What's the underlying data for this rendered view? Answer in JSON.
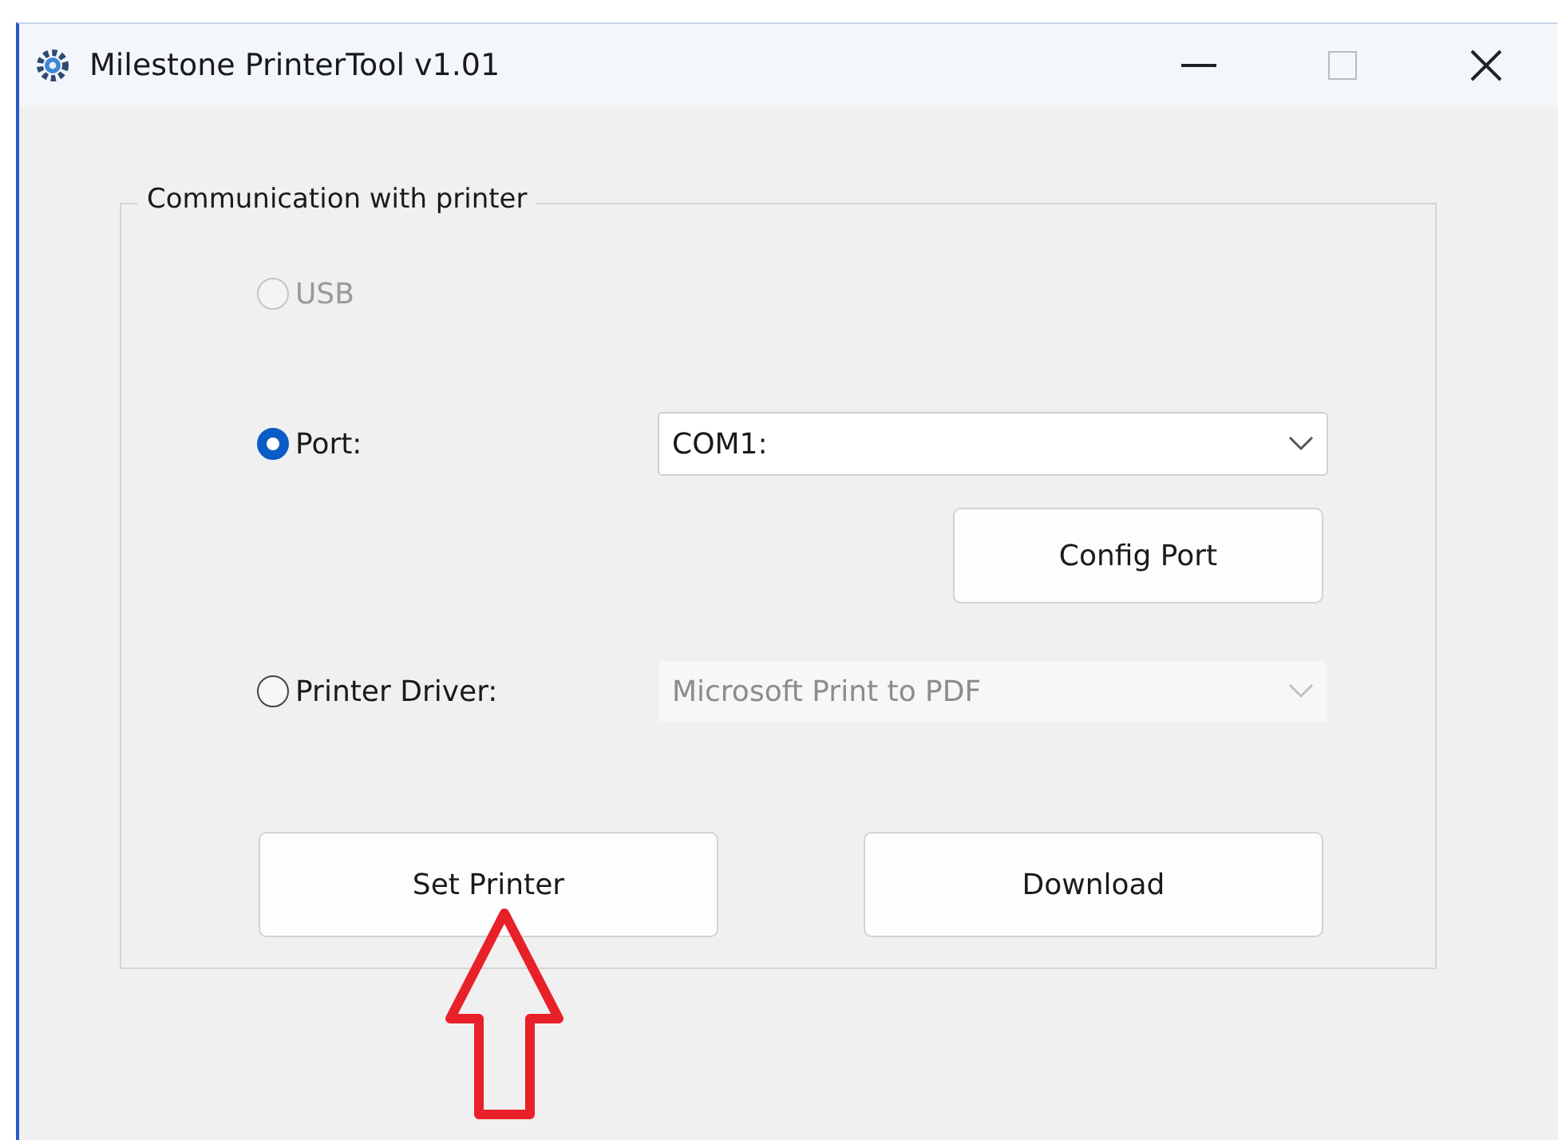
{
  "window": {
    "title": "Milestone PrinterTool v1.01"
  },
  "group": {
    "label": "Communication with printer"
  },
  "connection_options": [
    {
      "label": "USB",
      "selected": false,
      "disabled": true
    },
    {
      "label": "Port:",
      "selected": true,
      "disabled": false,
      "dropdown": {
        "value": "COM1:",
        "disabled": false
      },
      "button": "Config Port"
    },
    {
      "label": "Printer Driver:",
      "selected": false,
      "disabled": false,
      "dropdown": {
        "value": "Microsoft Print to PDF",
        "disabled": true
      }
    }
  ],
  "buttons": [
    "Set Printer",
    "Download"
  ]
}
